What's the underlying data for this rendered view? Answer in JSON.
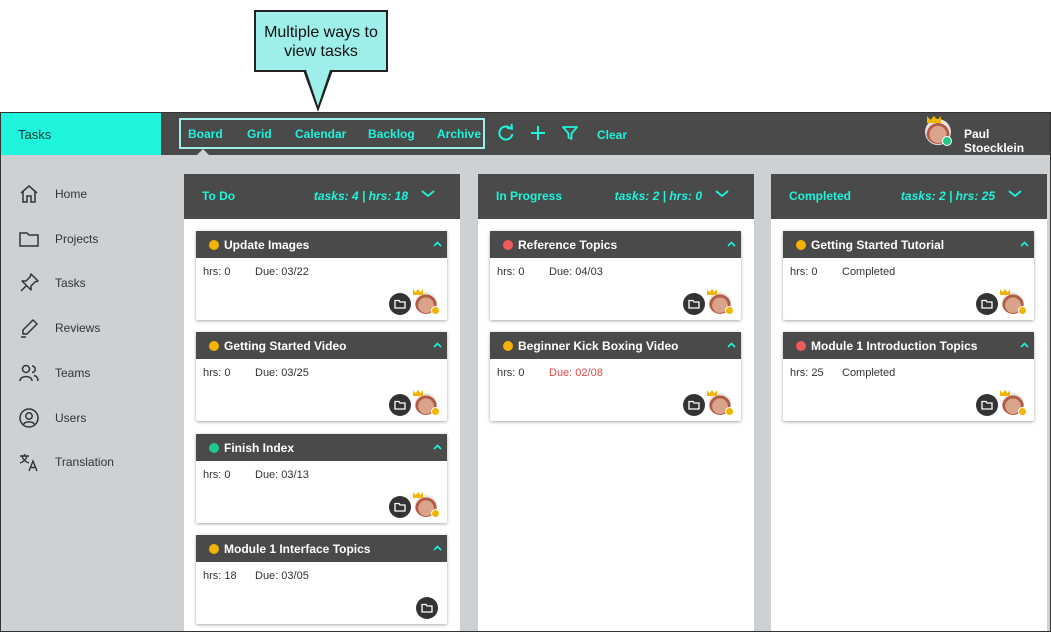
{
  "callout": {
    "line1": "Multiple ways to",
    "line2": "view tasks"
  },
  "brand": {
    "title": "Tasks"
  },
  "views": {
    "tabs": [
      {
        "label": "Board",
        "active": true
      },
      {
        "label": "Grid"
      },
      {
        "label": "Calendar"
      },
      {
        "label": "Backlog"
      },
      {
        "label": "Archive"
      }
    ]
  },
  "toolbar": {
    "refresh_icon": "refresh-icon",
    "add_icon": "plus-icon",
    "filter_icon": "filter-icon",
    "clear_label": "Clear"
  },
  "user": {
    "name": "Paul Stoecklein",
    "status": "online"
  },
  "sidebar": {
    "items": [
      {
        "label": "Home",
        "icon": "home-icon"
      },
      {
        "label": "Projects",
        "icon": "folder-icon"
      },
      {
        "label": "Tasks",
        "icon": "pin-icon"
      },
      {
        "label": "Reviews",
        "icon": "pen-icon"
      },
      {
        "label": "Teams",
        "icon": "people-icon"
      },
      {
        "label": "Users",
        "icon": "user-icon"
      },
      {
        "label": "Translation",
        "icon": "translate-icon"
      }
    ]
  },
  "colors": {
    "accent": "#1ef5dc",
    "header": "#4a4a4a",
    "orange": "#f4b400",
    "red": "#f05a5a",
    "green": "#1ec98b",
    "overdue": "#e24a4a"
  },
  "columns": [
    {
      "title": "To Do",
      "stats": "tasks: 4 | hrs: 18",
      "cards": [
        {
          "title": "Update Images",
          "priority": "orange",
          "hrs": "hrs: 0",
          "due": "Due: 03/22",
          "assigned": true
        },
        {
          "title": "Getting Started Video",
          "priority": "orange",
          "hrs": "hrs: 0",
          "due": "Due: 03/25",
          "assigned": true
        },
        {
          "title": "Finish Index",
          "priority": "green",
          "hrs": "hrs: 0",
          "due": "Due: 03/13",
          "assigned": true
        },
        {
          "title": "Module 1 Interface Topics",
          "priority": "orange",
          "hrs": "hrs: 18",
          "due": "Due: 03/05",
          "assigned": false
        }
      ]
    },
    {
      "title": "In Progress",
      "stats": "tasks: 2 | hrs: 0",
      "cards": [
        {
          "title": "Reference Topics",
          "priority": "red",
          "hrs": "hrs: 0",
          "due": "Due: 04/03",
          "assigned": true
        },
        {
          "title": "Beginner Kick Boxing Video",
          "priority": "orange",
          "hrs": "hrs: 0",
          "due": "Due: 02/08",
          "overdue": true,
          "assigned": true
        }
      ]
    },
    {
      "title": "Completed",
      "stats": "tasks: 2 | hrs: 25",
      "cards": [
        {
          "title": "Getting Started Tutorial",
          "priority": "orange",
          "hrs": "hrs: 0",
          "due": "Completed",
          "assigned": true
        },
        {
          "title": "Module 1 Introduction Topics",
          "priority": "red",
          "hrs": "hrs: 25",
          "due": "Completed",
          "assigned": true
        }
      ]
    }
  ]
}
